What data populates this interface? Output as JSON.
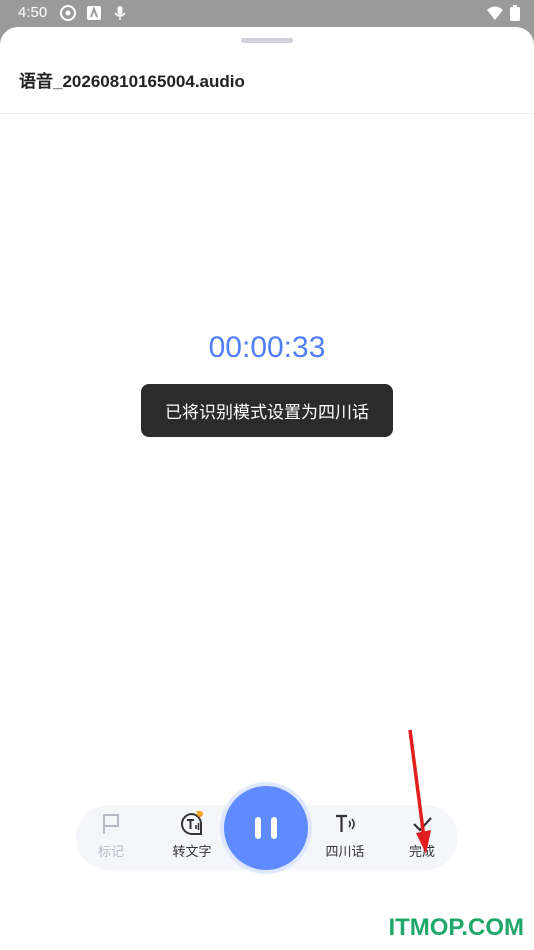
{
  "status_bar": {
    "time": "4:50"
  },
  "header": {
    "file_name": "语音_20260810165004.audio"
  },
  "recorder": {
    "elapsed": "00:00:33"
  },
  "toast": {
    "message": "已将识别模式设置为四川话"
  },
  "controls": {
    "mark_label": "标记",
    "transcribe_label": "转文字",
    "dialect_label": "四川话",
    "done_label": "完成"
  },
  "watermark": {
    "text": "ITMOP.COM"
  },
  "colors": {
    "accent": "#5e8bff",
    "timer": "#4f7ff7",
    "toast_bg": "#2b2b2b",
    "arrow": "#e01e1e"
  }
}
